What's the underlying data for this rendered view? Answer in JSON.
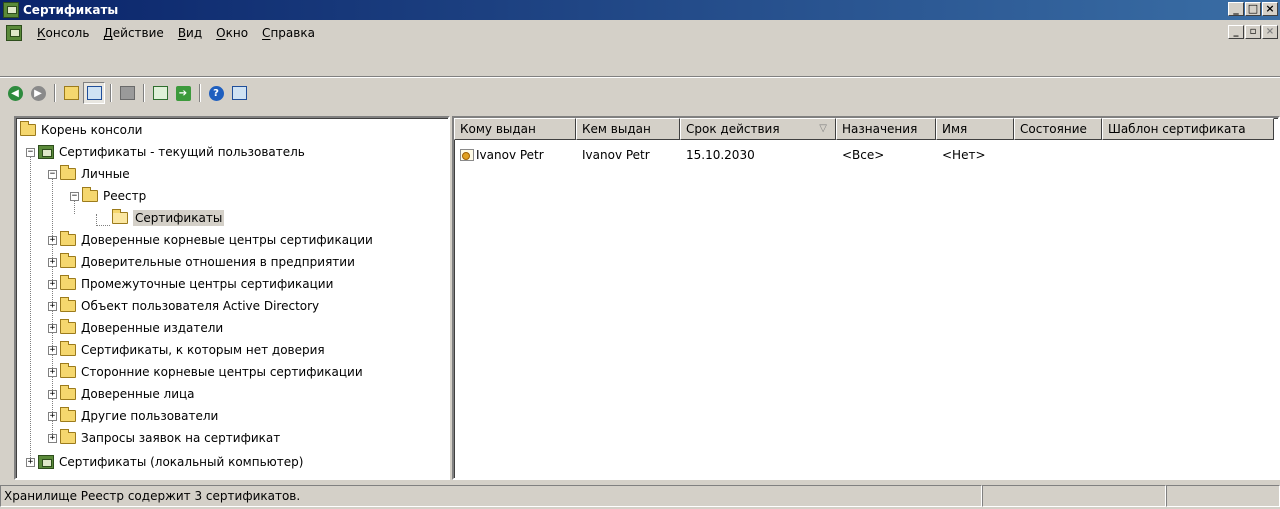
{
  "window": {
    "title": "Сертификаты"
  },
  "menu": {
    "items": [
      {
        "first": "К",
        "rest": "онсоль"
      },
      {
        "first": "Д",
        "rest": "ействие"
      },
      {
        "first": "В",
        "rest": "ид"
      },
      {
        "first": "О",
        "rest": "кно"
      },
      {
        "first": "С",
        "rest": "правка"
      }
    ]
  },
  "toolbar": {
    "icons": [
      "back-icon",
      "forward-icon",
      "up-level-icon",
      "show-hide-tree-icon",
      "delete-icon",
      "refresh-icon",
      "export-list-icon",
      "help-icon",
      "properties-icon"
    ]
  },
  "tree": {
    "root": "Корень консоли",
    "current_user": "Сертификаты - текущий пользователь",
    "personal": "Личные",
    "registry": "Реестр",
    "certificates": "Сертификаты",
    "stores": [
      "Доверенные корневые центры сертификации",
      "Доверительные отношения в предприятии",
      "Промежуточные центры сертификации",
      "Объект пользователя Active Directory",
      "Доверенные издатели",
      "Сертификаты, к которым нет доверия",
      "Сторонние корневые центры сертификации",
      "Доверенные лица",
      "Другие пользователи",
      "Запросы заявок на сертификат"
    ],
    "local_computer": "Сертификаты (локальный компьютер)"
  },
  "list": {
    "columns": [
      "Кому выдан",
      "Кем выдан",
      "Срок действия",
      "Назначения",
      "Имя",
      "Состояние",
      "Шаблон сертификата"
    ],
    "rows": [
      {
        "issued_to": "Ivanov Petr",
        "issued_by": "Ivanov Petr",
        "expires": "15.10.2030",
        "purposes": "<Все>",
        "name": "<Нет>",
        "status": "",
        "template": ""
      }
    ]
  },
  "status": {
    "text": "Хранилище Реестр содержит 3 сертификатов."
  },
  "colors": {
    "titlebar": "#0a246a",
    "face": "#d4d0c8"
  }
}
